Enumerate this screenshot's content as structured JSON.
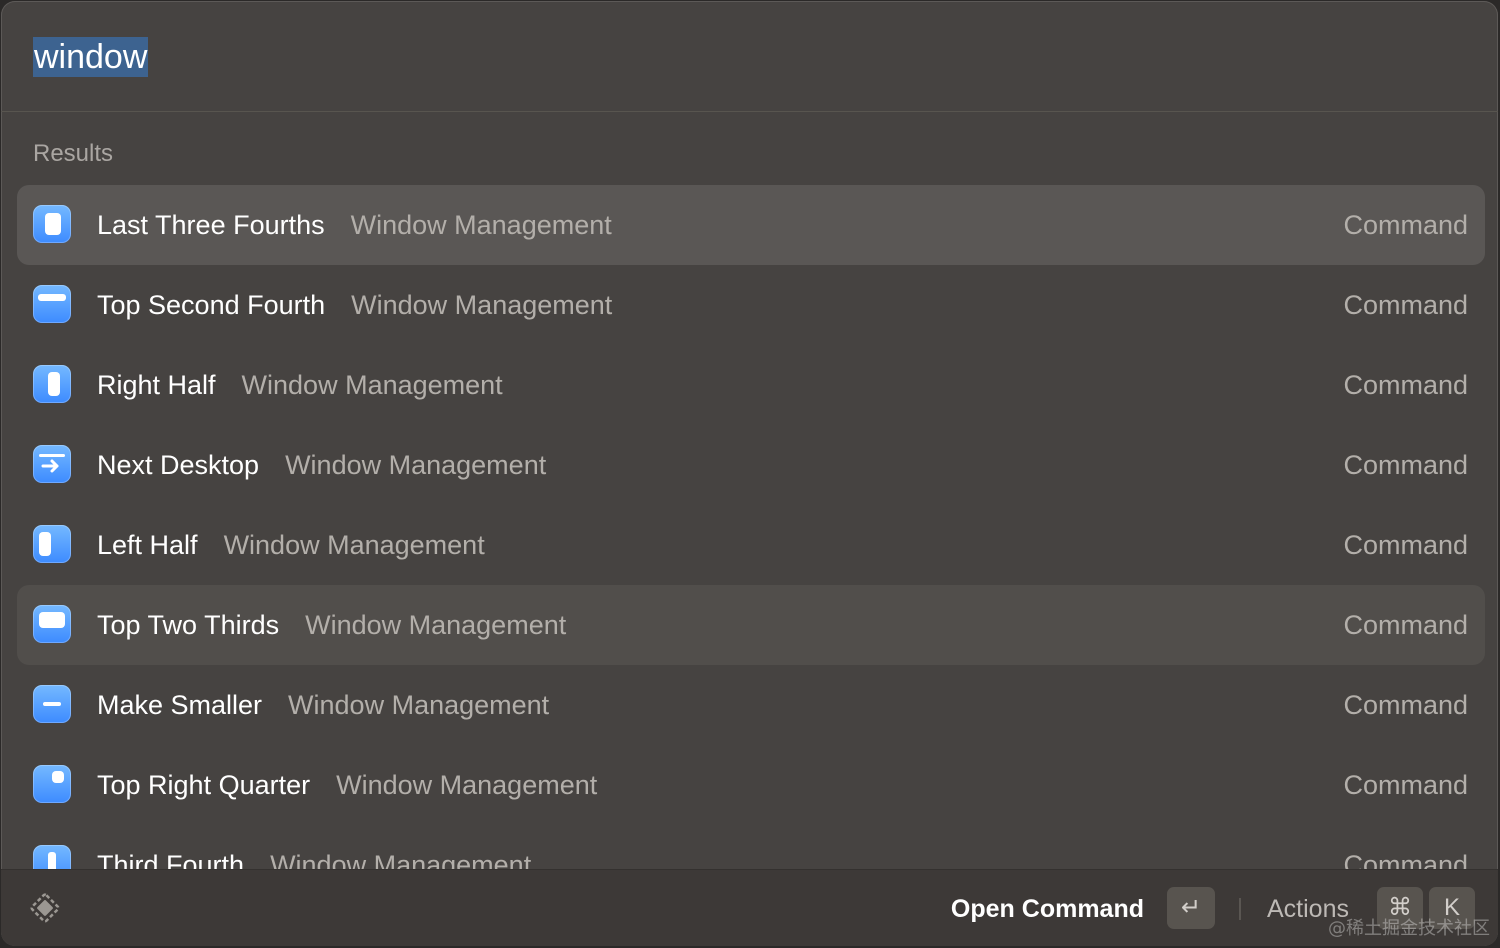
{
  "search": {
    "query": "window"
  },
  "results": {
    "section_title": "Results",
    "items": [
      {
        "title": "Last Three Fourths",
        "subtitle": "Window Management",
        "accessory": "Command",
        "icon": "last-three-fourths-icon"
      },
      {
        "title": "Top Second Fourth",
        "subtitle": "Window Management",
        "accessory": "Command",
        "icon": "top-second-fourth-icon"
      },
      {
        "title": "Right Half",
        "subtitle": "Window Management",
        "accessory": "Command",
        "icon": "right-half-icon"
      },
      {
        "title": "Next Desktop",
        "subtitle": "Window Management",
        "accessory": "Command",
        "icon": "next-desktop-icon"
      },
      {
        "title": "Left Half",
        "subtitle": "Window Management",
        "accessory": "Command",
        "icon": "left-half-icon"
      },
      {
        "title": "Top Two Thirds",
        "subtitle": "Window Management",
        "accessory": "Command",
        "icon": "top-two-thirds-icon"
      },
      {
        "title": "Make Smaller",
        "subtitle": "Window Management",
        "accessory": "Command",
        "icon": "make-smaller-icon"
      },
      {
        "title": "Top Right Quarter",
        "subtitle": "Window Management",
        "accessory": "Command",
        "icon": "top-right-quarter-icon"
      },
      {
        "title": "Third Fourth",
        "subtitle": "Window Management",
        "accessory": "Command",
        "icon": "third-fourth-icon"
      }
    ]
  },
  "action_bar": {
    "logo_icon": "raycast-logo-icon",
    "primary_label": "Open Command",
    "enter_key": "↵",
    "actions_label": "Actions",
    "cmd_key": "⌘",
    "k_key": "K"
  },
  "watermark": "@稀土掘金技术社区",
  "colors": {
    "background": "#464341",
    "selection": "#5a5755",
    "accent_icon": "#4a97ff",
    "search_highlight": "#3d6390"
  }
}
